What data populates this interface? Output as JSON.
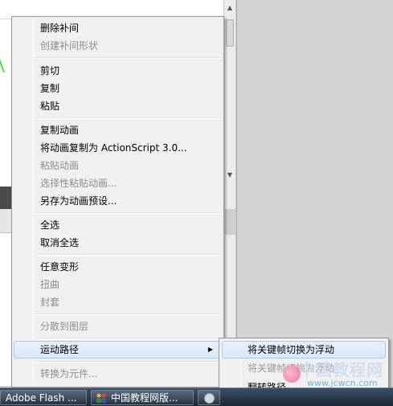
{
  "context_menu": {
    "items": [
      {
        "label": "删除补间",
        "enabled": true
      },
      {
        "label": "创建补间形状",
        "enabled": false
      },
      {
        "label": "剪切",
        "enabled": true
      },
      {
        "label": "复制",
        "enabled": true
      },
      {
        "label": "粘贴",
        "enabled": true
      },
      {
        "label": "复制动画",
        "enabled": true
      },
      {
        "label": "将动画复制为 ActionScript 3.0...",
        "enabled": true
      },
      {
        "label": "粘贴动画",
        "enabled": false
      },
      {
        "label": "选择性粘贴动画...",
        "enabled": false
      },
      {
        "label": "另存为动画预设...",
        "enabled": true
      },
      {
        "label": "全选",
        "enabled": true
      },
      {
        "label": "取消全选",
        "enabled": true
      },
      {
        "label": "任意变形",
        "enabled": true
      },
      {
        "label": "扭曲",
        "enabled": false
      },
      {
        "label": "封套",
        "enabled": false
      },
      {
        "label": "分散到图层",
        "enabled": false
      },
      {
        "label": "运动路径",
        "enabled": true,
        "has_submenu": true,
        "highlighted": true
      },
      {
        "label": "转换为元件...",
        "enabled": false
      }
    ]
  },
  "submenu": {
    "items": [
      {
        "label": "将关键帧切换为浮动",
        "enabled": true,
        "highlighted": true
      },
      {
        "label": "将关键帧切换为浮动",
        "enabled": false
      },
      {
        "label": "翻转路径",
        "enabled": true
      }
    ]
  },
  "taskbar": {
    "items": [
      {
        "label": "Adobe Flash ..."
      },
      {
        "label": "中国教程网版..."
      },
      {
        "label": ""
      }
    ]
  },
  "watermark": {
    "top": "中国教程网",
    "bottom": "www.jcwcn.com"
  },
  "colors": {
    "highlight_bg": "#d7e7fb",
    "highlight_border": "#a9c9f0",
    "menu_bg": "#f0f0f0",
    "disabled_text": "#8d8d8d",
    "taskbar": "#1c2836"
  },
  "icons": {
    "submenu_arrow": "triangle-right-icon",
    "browser_icon": "people-icon",
    "third_app_icon": "app-icon"
  }
}
